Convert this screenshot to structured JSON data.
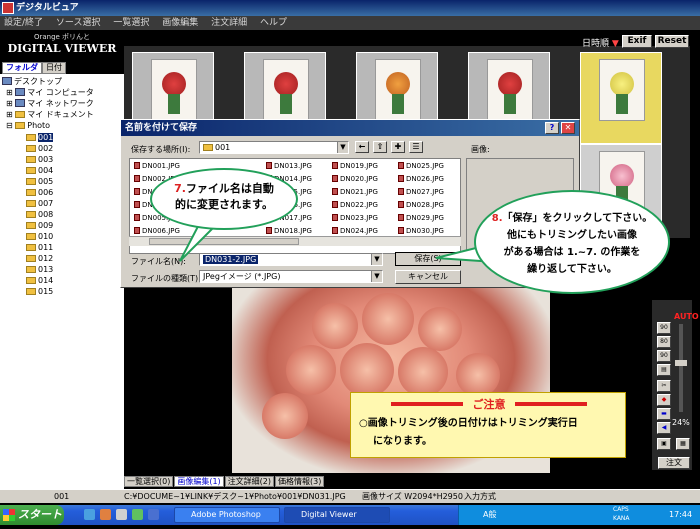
{
  "window": {
    "title": "デジタルビュア"
  },
  "menu": [
    "設定/終了",
    "ソース選択",
    "一覧選択",
    "画像編集",
    "注文詳細",
    "ヘルプ"
  ],
  "brand": {
    "small": "Orange ポリんと",
    "name": "DIGITAL VIEWER"
  },
  "left_tabs": [
    "フォルダ",
    "日付"
  ],
  "tree": {
    "top": [
      "デスクトップ",
      "マイ コンピュータ",
      "マイ ネットワーク",
      "マイ ドキュメント",
      "Photo"
    ],
    "folders": [
      "001",
      "002",
      "003",
      "004",
      "005",
      "006",
      "007",
      "008",
      "009",
      "010",
      "011",
      "012",
      "013",
      "014",
      "015"
    ]
  },
  "topright": {
    "sort_label": "日時順",
    "exif": "Exif",
    "reset": "Reset"
  },
  "dialog": {
    "title": "名前を付けて保存",
    "save_in_label": "保存する場所(I):",
    "save_in_value": "001",
    "preview_label": "画像:",
    "files": [
      "DN001.JPG",
      "DN002.JPG",
      "DN003.JPG",
      "DN004.JPG",
      "DN005.JPG",
      "DN006.JPG",
      "DN013.JPG",
      "DN014.JPG",
      "DN015.JPG",
      "DN016.JPG",
      "DN017.JPG",
      "DN018.JPG",
      "DN019.JPG",
      "DN020.JPG",
      "DN021.JPG",
      "DN022.JPG",
      "DN023.JPG",
      "DN024.JPG",
      "DN025.JPG",
      "DN026.JPG",
      "DN027.JPG",
      "DN028.JPG",
      "DN029.JPG",
      "DN030.JPG"
    ],
    "filename_label": "ファイル名(N):",
    "filename_value": "DN031-2.JPG",
    "filetype_label": "ファイルの種類(T):",
    "filetype_value": "JPegイメージ (*.JPG)",
    "save_button": "保存(S)",
    "cancel_button": "キャンセル"
  },
  "callout7": {
    "num": "7.",
    "line1": "ファイル名は自動",
    "line2": "的に変更されます。"
  },
  "callout8": {
    "num": "8.",
    "line1": "「保存」をクリックして下さい。",
    "line2": "他にもトリミングしたい画像",
    "line3": "がある場合は 1.~7. の作業を",
    "line4": "繰り返して下さい。"
  },
  "notice": {
    "title": "ご注意",
    "line1": "○画像トリミング後の日付けはトリミング実行日",
    "line2": "になります。"
  },
  "tools": {
    "auto": "AUTO",
    "percent": "24%"
  },
  "bottom_tabs": [
    "一覧選択(0)",
    "画像編集(1)",
    "注文詳細(2)",
    "価格情報(3)"
  ],
  "order_button": "注文",
  "status": {
    "folder": "001",
    "path": "C:¥DOCUME~1¥LINK¥デスク~1¥Photo¥001¥DN031.JPG",
    "size": "画像サイズ W2094*H2950",
    "mode": "入力方式"
  },
  "taskbar": {
    "start": "スタート",
    "items": [
      "Adobe Photoshop",
      "Digital Viewer"
    ],
    "tray_ime": "A般",
    "clock": "17:44",
    "caps": "CAPS",
    "kana": "KANA"
  }
}
